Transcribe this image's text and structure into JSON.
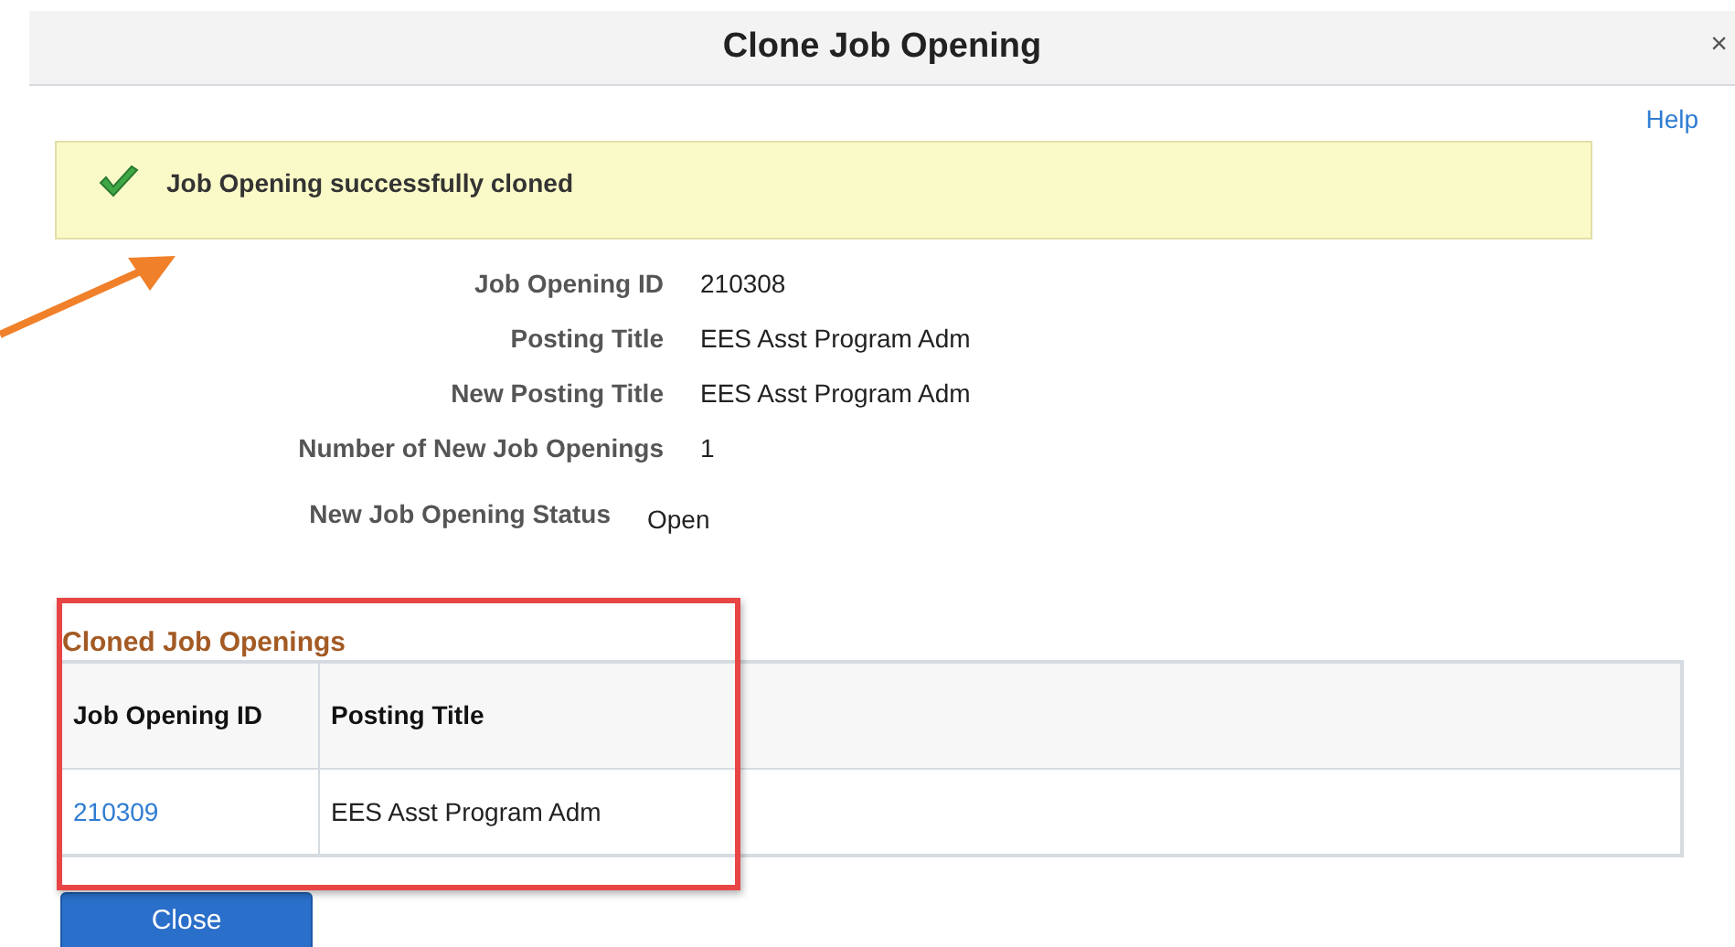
{
  "dialog": {
    "title": "Clone Job Opening",
    "close": "×",
    "help": "Help"
  },
  "message": {
    "text": "Job Opening successfully cloned"
  },
  "fields": [
    {
      "label": "Job Opening ID",
      "value": "210308"
    },
    {
      "label": "Posting Title",
      "value": "EES Asst Program Adm"
    },
    {
      "label": "New Posting Title",
      "value": "EES Asst Program Adm"
    },
    {
      "label": "Number of New Job Openings",
      "value": "1"
    },
    {
      "label": "New Job Opening Status",
      "value": "Open"
    }
  ],
  "cloned": {
    "title": "Cloned Job Openings",
    "columns": [
      "Job Opening ID",
      "Posting Title"
    ],
    "rows": [
      {
        "id": "210309",
        "title": "EES Asst Program Adm"
      }
    ]
  },
  "buttons": [
    "Close"
  ]
}
